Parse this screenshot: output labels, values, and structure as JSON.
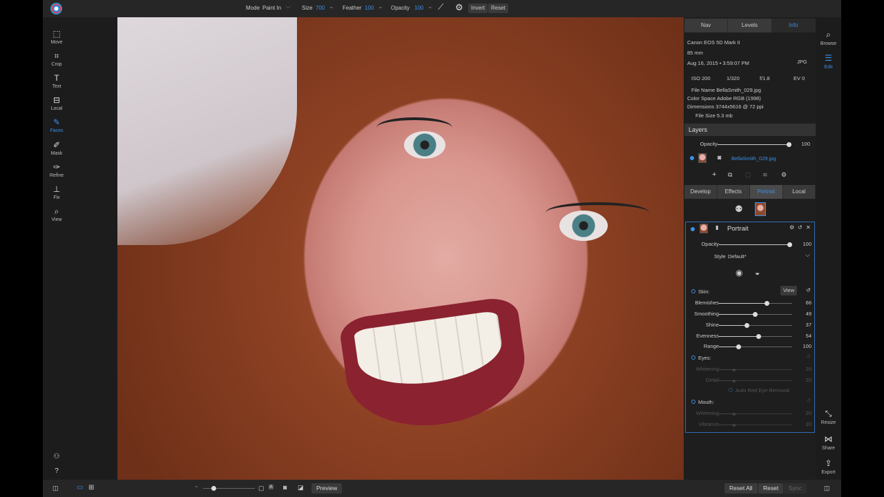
{
  "toolbar": {
    "mode_label": "Mode",
    "mode_value": "Paint In",
    "size_label": "Size",
    "size_value": "700",
    "feather_label": "Feather",
    "feather_value": "100",
    "opacity_label": "Opacity",
    "opacity_value": "100",
    "invert": "Invert",
    "reset": "Reset"
  },
  "tools": [
    {
      "label": "Move",
      "icon": "marquee-icon"
    },
    {
      "label": "Crop",
      "icon": "crop-icon"
    },
    {
      "label": "Text",
      "icon": "text-icon"
    },
    {
      "label": "Local",
      "icon": "local-icon"
    },
    {
      "label": "Faces",
      "icon": "brush-icon"
    },
    {
      "label": "Mask",
      "icon": "mask-brush-icon"
    },
    {
      "label": "Refine",
      "icon": "refine-brush-icon"
    },
    {
      "label": "Fix",
      "icon": "stamp-icon"
    },
    {
      "label": "View",
      "icon": "magnifier-icon"
    }
  ],
  "panel_tabs": [
    "Nav",
    "Levels",
    "Info"
  ],
  "info": {
    "camera": "Canon EOS 5D Mark II",
    "lens": "85 mm",
    "date": "Aug 16, 2015 • 3:59:07 PM",
    "format": "JPG",
    "iso": "ISO 200",
    "shutter": "1/320",
    "aperture": "f/1.8",
    "ev": "EV 0",
    "file_name": "File Name BellaSmith_029.jpg",
    "color_space": "Color Space Adobe RGB (1998)",
    "dimensions": "Dimensions 3744x5616 @ 72 ppi",
    "file_size": "File Size 5.3 mb"
  },
  "layers": {
    "title": "Layers",
    "opacity_label": "Opacity",
    "opacity_value": "100",
    "layer_name": "BellaSmith_029.jpg"
  },
  "module_tabs": [
    "Develop",
    "Effects",
    "Portrait",
    "Local"
  ],
  "portrait": {
    "title": "Portrait",
    "opacity_label": "Opacity",
    "opacity_value": "100",
    "style_label": "Style",
    "style_value": "Default*",
    "skin_label": "Skin:",
    "view_button": "View",
    "skin_sliders": [
      {
        "label": "Blemishes",
        "value": "66"
      },
      {
        "label": "Smoothing",
        "value": "49"
      },
      {
        "label": "Shine",
        "value": "37"
      },
      {
        "label": "Evenness",
        "value": "54"
      },
      {
        "label": "Range",
        "value": "100"
      }
    ],
    "eyes_label": "Eyes:",
    "eyes_sliders": [
      {
        "label": "Whitening",
        "value": "20"
      },
      {
        "label": "Detail",
        "value": "20"
      }
    ],
    "red_eye": "Auto Red Eye Removal",
    "mouth_label": "Mouth:",
    "mouth_sliders": [
      {
        "label": "Whitening",
        "value": "20"
      },
      {
        "label": "Vibrance",
        "value": "20"
      }
    ]
  },
  "right_strip": [
    {
      "label": "Browse",
      "icon": "browse-icon"
    },
    {
      "label": "Edit",
      "icon": "sliders-icon"
    },
    {
      "label": "Resize",
      "icon": "resize-icon"
    },
    {
      "label": "Share",
      "icon": "share-icon"
    },
    {
      "label": "Export",
      "icon": "export-icon"
    }
  ],
  "bottom": {
    "preview": "Preview",
    "reset_all": "Reset All",
    "reset": "Reset",
    "sync": "Sync"
  }
}
